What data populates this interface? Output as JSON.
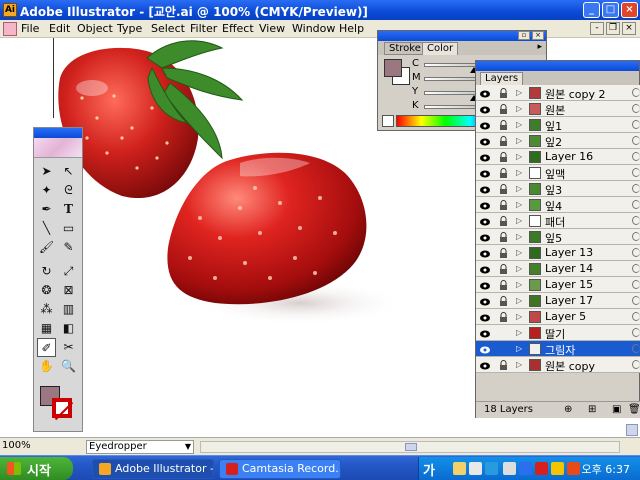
{
  "window": {
    "title": "Adobe Illustrator - [교안.ai @ 100% (CMYK/Preview)]",
    "controls": {
      "minimize": "_",
      "maximize": "□",
      "close": "×"
    }
  },
  "menubar": {
    "items": [
      "File",
      "Edit",
      "Object",
      "Type",
      "Select",
      "Filter",
      "Effect",
      "View",
      "Window",
      "Help"
    ],
    "doc_controls": {
      "minimize": "-",
      "restore": "❐",
      "close": "×"
    }
  },
  "toolbox": {
    "tools": [
      "selection",
      "direct-selection",
      "magic-wand",
      "lasso",
      "pen",
      "type",
      "line",
      "rectangle",
      "paintbrush",
      "pencil",
      "rotate",
      "scale",
      "warp",
      "free-transform",
      "symbol-sprayer",
      "column-graph",
      "mesh",
      "gradient",
      "eyedropper",
      "scissors",
      "hand",
      "zoom"
    ],
    "fill_color": "#9a7781",
    "stroke_color": "#cc0000"
  },
  "status": {
    "zoom": "100%",
    "current_tool": "Eyedropper"
  },
  "color_panel": {
    "tabs": [
      "Stroke",
      "Color"
    ],
    "active_tab": "Color",
    "sliders": [
      {
        "label": "C",
        "level": 0.45
      },
      {
        "label": "M",
        "level": 0.55
      },
      {
        "label": "Y",
        "level": 0.45
      },
      {
        "label": "K",
        "level": 0.5
      }
    ]
  },
  "layers_panel": {
    "tab": "Layers",
    "layers": [
      {
        "name": "원본 copy 2",
        "visible": true,
        "locked": true,
        "selected": false,
        "thumb": "#b23a3a"
      },
      {
        "name": "원본",
        "visible": true,
        "locked": true,
        "selected": false,
        "thumb": "#c85a5a"
      },
      {
        "name": "잎1",
        "visible": true,
        "locked": true,
        "selected": false,
        "thumb": "#3e7d2a"
      },
      {
        "name": "잎2",
        "visible": true,
        "locked": true,
        "selected": false,
        "thumb": "#4d8a34"
      },
      {
        "name": "Layer 16",
        "visible": true,
        "locked": true,
        "selected": false,
        "thumb": "#2e6d20"
      },
      {
        "name": "잎맥",
        "visible": true,
        "locked": true,
        "selected": false,
        "thumb": "#ffffff"
      },
      {
        "name": "잎3",
        "visible": true,
        "locked": true,
        "selected": false,
        "thumb": "#4a8a2e"
      },
      {
        "name": "잎4",
        "visible": true,
        "locked": true,
        "selected": false,
        "thumb": "#5a9a3e"
      },
      {
        "name": "패더",
        "visible": true,
        "locked": true,
        "selected": false,
        "thumb": "#ffffff"
      },
      {
        "name": "잎5",
        "visible": true,
        "locked": true,
        "selected": false,
        "thumb": "#3b7a26"
      },
      {
        "name": "Layer 13",
        "visible": true,
        "locked": true,
        "selected": false,
        "thumb": "#2f6a1e"
      },
      {
        "name": "Layer 14",
        "visible": true,
        "locked": true,
        "selected": false,
        "thumb": "#447f2c"
      },
      {
        "name": "Layer 15",
        "visible": true,
        "locked": true,
        "selected": false,
        "thumb": "#6a9a4a"
      },
      {
        "name": "Layer 17",
        "visible": true,
        "locked": true,
        "selected": false,
        "thumb": "#3e7424"
      },
      {
        "name": "Layer 5",
        "visible": true,
        "locked": true,
        "selected": false,
        "thumb": "#c04848"
      },
      {
        "name": "딸기",
        "visible": true,
        "locked": false,
        "selected": false,
        "thumb": "#b82020"
      },
      {
        "name": "그림자",
        "visible": true,
        "locked": false,
        "selected": true,
        "thumb": "#f0f0f0"
      },
      {
        "name": "원본 copy",
        "visible": true,
        "locked": true,
        "selected": false,
        "thumb": "#aa3030"
      }
    ],
    "footer_count": "18 Layers"
  },
  "taskbar": {
    "start_label": "시작",
    "items": [
      {
        "label": "Adobe Illustrator -...",
        "icon_color": "#f5a623",
        "active": true
      },
      {
        "label": "Camtasia Record...",
        "icon_color": "#d62020",
        "active": false
      }
    ],
    "ime": "가",
    "clock": "오후 6:37"
  }
}
